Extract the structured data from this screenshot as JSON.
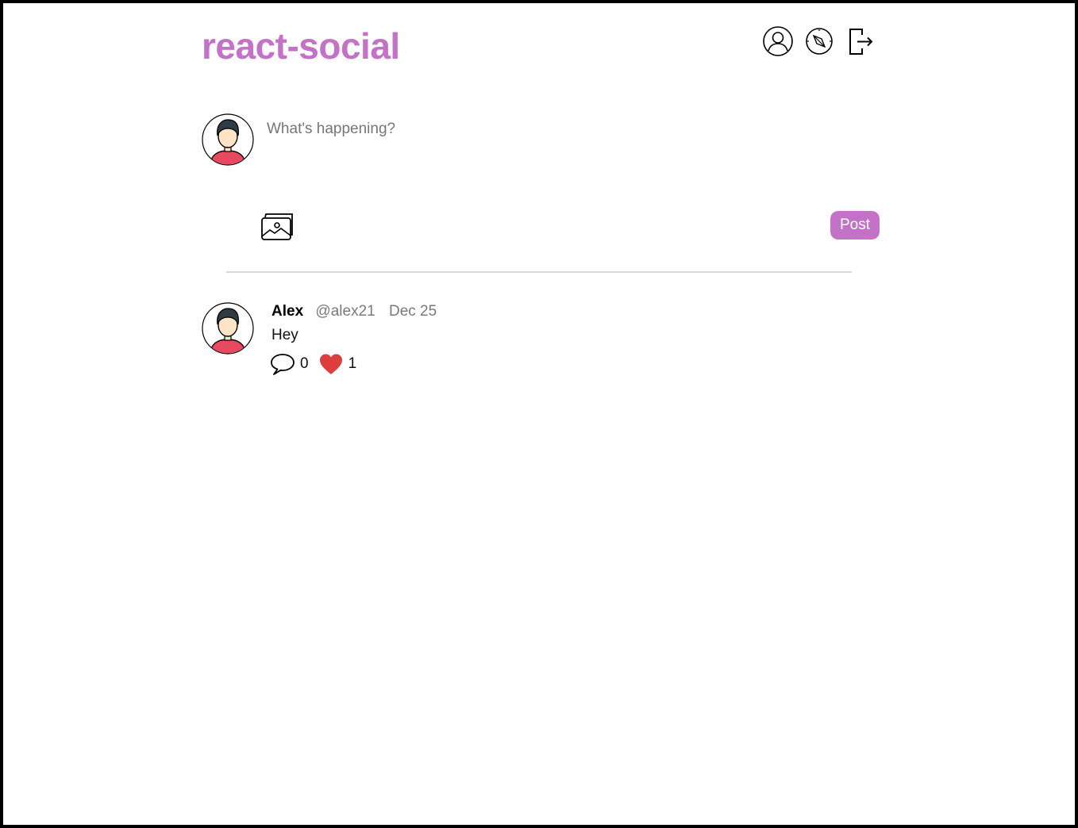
{
  "header": {
    "logo": "react-social",
    "nav": [
      {
        "icon": "user-profile-icon"
      },
      {
        "icon": "compass-explore-icon"
      },
      {
        "icon": "logout-icon"
      }
    ]
  },
  "composer": {
    "placeholder": "What's happening?",
    "media_icon": "image-gallery-icon",
    "post_label": "Post"
  },
  "feed": [
    {
      "author_name": "Alex",
      "author_handle": "@alex21",
      "date": "Dec 25",
      "text": "Hey",
      "comments": "0",
      "likes": "1",
      "liked": true
    }
  ],
  "colors": {
    "brand": "#c372c7",
    "like": "#dc3d3d",
    "muted_text": "#7a7a7a",
    "avatar_shirt": "#e8495e",
    "avatar_skin": "#fde4c4"
  }
}
